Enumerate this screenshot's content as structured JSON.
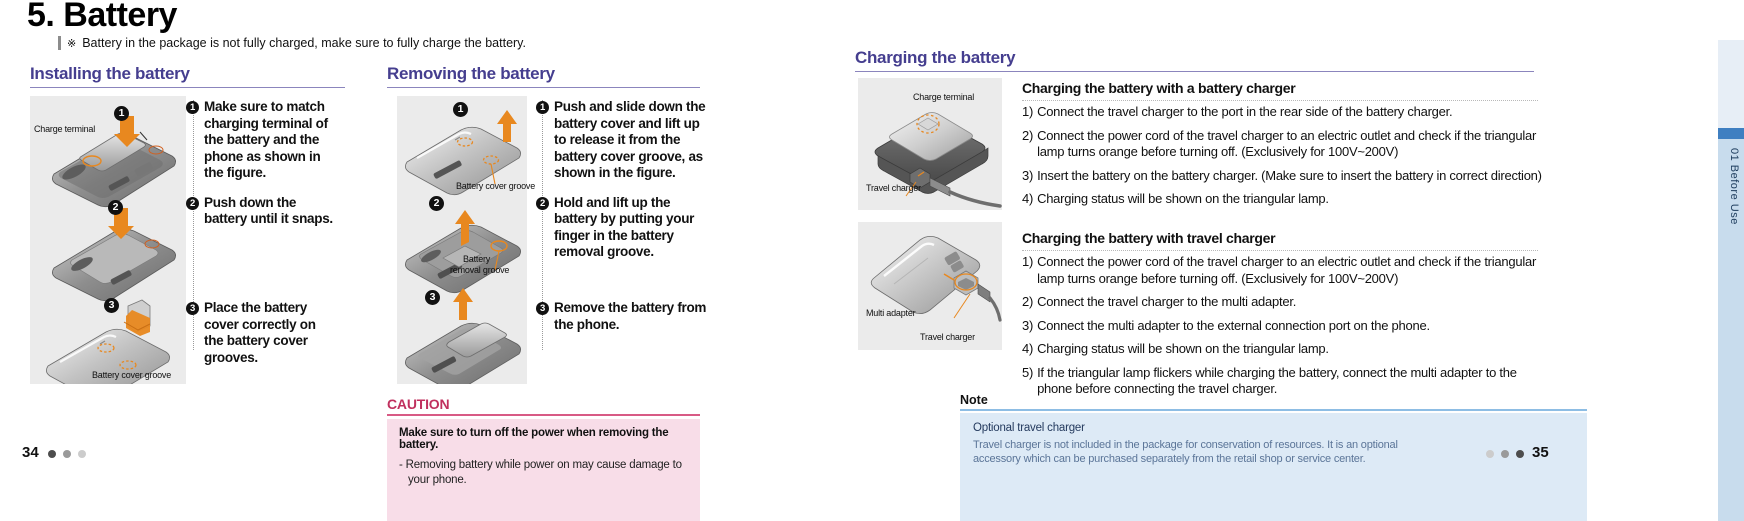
{
  "document": {
    "main_title": "5. Battery",
    "note_mark": "※",
    "note_text": "Battery in the package is not fully charged, make sure to fully charge the battery."
  },
  "left_page": {
    "page_number": "34",
    "sections": [
      {
        "heading": "Installing the battery",
        "illustration_labels": [
          "Charge terminal",
          "Battery cover groove"
        ],
        "illustration_step_markers": [
          "❶",
          "❷",
          "❸"
        ],
        "steps": [
          {
            "num": "❶",
            "text": "Make sure to match charging terminal of the battery and the phone as shown in the figure."
          },
          {
            "num": "❷",
            "text": "Push down the battery until it snaps."
          },
          {
            "num": "❸",
            "text": "Place the battery cover correctly on the battery cover grooves."
          }
        ]
      },
      {
        "heading": "Removing the battery",
        "illustration_labels": [
          "Battery cover groove",
          "Battery",
          "removal groove"
        ],
        "illustration_step_markers": [
          "❶",
          "❷",
          "❸"
        ],
        "steps": [
          {
            "num": "❶",
            "text": "Push and slide down the battery cover and lift up to release it from the battery cover groove, as shown in the figure."
          },
          {
            "num": "❷",
            "text": "Hold and lift up the battery by putting your finger in the battery removal groove."
          },
          {
            "num": "❸",
            "text": "Remove the battery from the phone."
          }
        ]
      }
    ],
    "caution": {
      "title": "CAUTION",
      "headline": "Make sure to turn off the power when removing the battery.",
      "body_line1": "- Removing battery while power on may cause damage to",
      "body_line2": "your phone."
    }
  },
  "right_page": {
    "page_number": "35",
    "section_heading": "Charging the battery",
    "blocks": [
      {
        "sub_heading": "Charging the battery with a battery charger",
        "illustration_labels": [
          "Charge terminal",
          "Travel charger"
        ],
        "items": [
          {
            "num": "1)",
            "text": "Connect the travel charger to the port in the rear side of the battery charger."
          },
          {
            "num": "2)",
            "text": "Connect the power cord of the travel charger to an electric outlet and check if the triangular lamp turns orange before turning off. (Exclusively for 100V~200V)"
          },
          {
            "num": "3)",
            "text": "Insert the battery on the battery charger. (Make sure to insert the battery in correct direction)"
          },
          {
            "num": "4)",
            "text": "Charging status will be shown on the triangular lamp."
          }
        ]
      },
      {
        "sub_heading": "Charging the battery with travel charger",
        "illustration_labels": [
          "Multi adapter",
          "Travel charger"
        ],
        "items": [
          {
            "num": "1)",
            "text": "Connect the power cord of the travel charger to an electric outlet and check if the triangular lamp turns orange before turning off. (Exclusively for 100V~200V)"
          },
          {
            "num": "2)",
            "text": "Connect the travel charger to the multi adapter."
          },
          {
            "num": "3)",
            "text": "Connect the multi adapter to the external connection port on the phone."
          },
          {
            "num": "4)",
            "text": "Charging status will be shown on the triangular lamp."
          },
          {
            "num": "5)",
            "text": "If the triangular lamp flickers while charging the battery, connect the multi adapter to the phone before connecting the travel charger."
          }
        ]
      }
    ],
    "note": {
      "title": "Note",
      "headline": "Optional travel charger",
      "body_line1": "Travel charger is not included in the package for conservation of resources. It is an optional",
      "body_line2": "accessory which can be purchased separately from the retail shop or service center."
    }
  },
  "side_tab": {
    "label": "01 Before Use"
  },
  "colors": {
    "heading_purple": "#453e8f",
    "caution_crimson": "#c0305e",
    "caution_bg": "#f8dde8",
    "note_blue_rule": "#8dbde4",
    "note_bg": "#ddeaf6",
    "tab_blue": "#3f7fc1",
    "tab_body": "#c8dced",
    "illustration_bg": "#ebebeb",
    "accent_orange": "#e8881f"
  }
}
